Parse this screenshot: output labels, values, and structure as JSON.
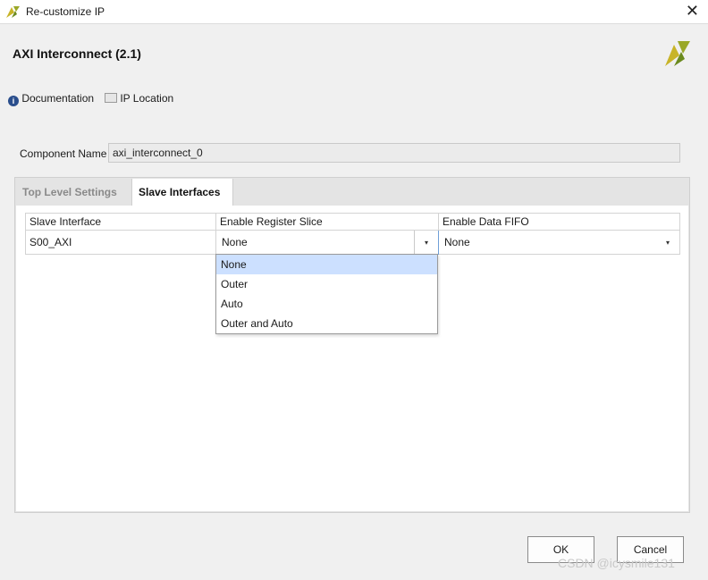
{
  "window": {
    "title": "Re-customize IP",
    "close_glyph": "✕"
  },
  "header": {
    "title": "AXI Interconnect (2.1)"
  },
  "links": {
    "documentation": "Documentation",
    "ip_location": "IP Location"
  },
  "component": {
    "label": "Component Name",
    "value": "axi_interconnect_0"
  },
  "tabs": [
    {
      "label": "Top Level Settings",
      "active": false
    },
    {
      "label": "Slave Interfaces",
      "active": true
    }
  ],
  "table": {
    "headers": [
      "Slave Interface",
      "Enable Register Slice",
      "Enable Data FIFO"
    ],
    "rows": [
      {
        "interface": "S00_AXI",
        "register_slice": "None",
        "data_fifo": "None"
      }
    ]
  },
  "dropdown": {
    "options": [
      "None",
      "Outer",
      "Auto",
      "Outer and Auto"
    ],
    "selected_index": 0,
    "caret_glyph": "▾"
  },
  "buttons": {
    "ok": "OK",
    "cancel": "Cancel"
  },
  "watermark": "CSDN @icysmile131",
  "colors": {
    "logo_yellow": "#c8b428",
    "logo_green": "#6b8a1e",
    "selection": "#cce0ff",
    "info_blue": "#2a4e8c"
  }
}
